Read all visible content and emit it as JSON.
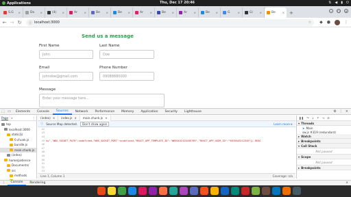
{
  "system_bar": {
    "apps_label": "Applications",
    "clock": "Thu, Dec 17   20:46"
  },
  "tabs": [
    {
      "label": "S.G",
      "color": "#e53935"
    },
    {
      "label": "Do",
      "color": "#9e9e9e"
    },
    {
      "label": "(4)",
      "color": "#333333"
    },
    {
      "label": "Ar",
      "color": "#d81b60"
    },
    {
      "label": "Be",
      "color": "#5c6bc0"
    },
    {
      "label": "Be",
      "color": "#1e88e5"
    },
    {
      "label": "Ar",
      "color": "#e91e63"
    },
    {
      "label": "Be",
      "color": "#3949ab"
    },
    {
      "label": "Ar",
      "color": "#8e24aa"
    },
    {
      "label": "Be",
      "color": "#1e88e5"
    },
    {
      "label": "G",
      "color": "#4285f4"
    },
    {
      "label": "Gi",
      "color": "#333333"
    },
    {
      "label": "Be",
      "color": "#fb8c00",
      "active": true
    }
  ],
  "address": {
    "url": "localhost:3000"
  },
  "form": {
    "title": "Send us a message",
    "first_name_label": "First Name",
    "first_name_placeholder": "John",
    "last_name_label": "Last Name",
    "last_name_placeholder": "Doe",
    "email_label": "Email",
    "email_placeholder": "johndoe@gmail.com",
    "phone_label": "Phone Number",
    "phone_placeholder": "09088880000",
    "message_label": "Message",
    "message_placeholder": "Enter your message here..."
  },
  "devtools": {
    "tabs": [
      "Elements",
      "Console",
      "Sources",
      "Network",
      "Performance",
      "Memory",
      "Application",
      "Security",
      "Lighthouse"
    ],
    "active_tab": "Sources",
    "navigator": {
      "header": "Page",
      "tree": [
        {
          "label": "top",
          "indent": 0,
          "icon": "#888888"
        },
        {
          "label": "localhost:3000",
          "indent": 1,
          "icon": "#888888"
        },
        {
          "label": "static/js",
          "indent": 2,
          "icon": "#f4b400"
        },
        {
          "label": "0.chunk.js",
          "indent": 3,
          "icon": "#f4b400"
        },
        {
          "label": "bundle.js",
          "indent": 3,
          "icon": "#f4b400"
        },
        {
          "label": "main.chunk.js",
          "indent": 3,
          "icon": "#f4b400"
        },
        {
          "label": "(index)",
          "indent": 2,
          "icon": "#888888"
        },
        {
          "label": "home/patience",
          "indent": 1,
          "icon": "#f4b400"
        },
        {
          "label": "Documents/",
          "indent": 2,
          "icon": "#f4b400"
        },
        {
          "label": "src",
          "indent": 2,
          "icon": "#f4b400"
        },
        {
          "label": "methods",
          "indent": 3,
          "icon": "#f4b400"
        },
        {
          "label": "pages",
          "indent": 3,
          "icon": "#f4b400"
        }
      ]
    },
    "editor": {
      "tabs": [
        "(index)",
        "index.js",
        "main.chunk.js"
      ],
      "info_text": "Source Map detected.",
      "dont_show": "Don't show again",
      "learn_more": "Learn more",
      "line_numbers": [
        "42",
        "43",
        "44",
        "45",
        "46",
        "47",
        "48",
        "49",
        "50",
        "51",
        "52",
        "53"
      ],
      "code_line": "ss\",\"WDS_SOCKET_PATH\":undefined,\"WDS_SOCKET_PORT\":undefined,\"REACT_APP_TEMPLATE_ID\":\"WD9SA3212345E789\",\"REACT_APP_USER_ID\":\"9876543212345\"}).REAC",
      "status_left": "Line 1, Column 1",
      "status_right": "Coverage: n/a"
    },
    "debugger": {
      "threads_label": "Threads",
      "thread_main": "Main",
      "thread_sw": "sw.js #319 (redundant)",
      "watch_label": "Watch",
      "breakpoints_label": "Breakpoints",
      "callstack_label": "Call Stack",
      "not_paused": "Not paused",
      "scope_label": "Scope",
      "scope_not_paused": "Not paused",
      "breakpoints2_label": "Breakpoints"
    },
    "drawer": {
      "console": "Console",
      "rendering": "Rendering"
    }
  },
  "dock_icons": [
    "#e64a19",
    "#fdd835",
    "#43a047",
    "#1e88e5",
    "#d81b60",
    "#8e24aa",
    "#ff7043",
    "#26a69a",
    "#ab47bc",
    "#5c6bc0",
    "#f4511e",
    "#ffb300",
    "#1565c0",
    "#00897b",
    "#c62828",
    "#7cb342",
    "#6d4c41",
    "#0277bd",
    "#ef6c00",
    "#455a64"
  ]
}
